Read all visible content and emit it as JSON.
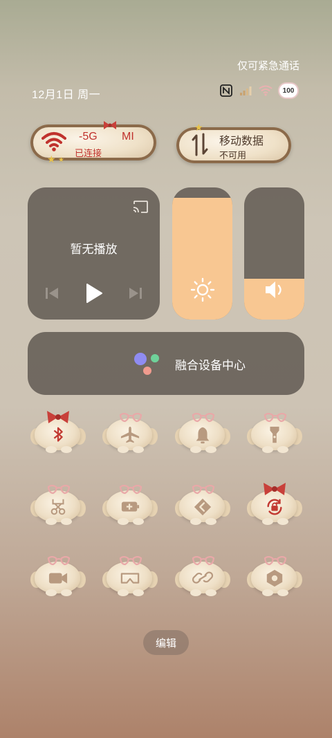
{
  "status_bar": {
    "emergency_text": "仅可紧急通话",
    "date_text": "12月1日 周一",
    "battery_level": "100",
    "icons": [
      "nfc-icon",
      "signal-icon",
      "wifi-icon",
      "battery-icon"
    ]
  },
  "tiles": {
    "wifi": {
      "title_a": "-5G",
      "title_b": "MI",
      "status": "已连接",
      "accent": "#c0322d"
    },
    "mobile_data": {
      "title": "移动数据",
      "status": "不可用"
    }
  },
  "media": {
    "title": "暂无播放",
    "icons": [
      "cast-icon",
      "previous-icon",
      "play-icon",
      "next-icon"
    ]
  },
  "sliders": {
    "brightness": {
      "level": 0.92,
      "icon": "sun-icon",
      "color": "#f8c792"
    },
    "volume": {
      "level": 0.31,
      "icon": "speaker-icon",
      "color": "#f8c792"
    }
  },
  "fusion": {
    "label": "融合设备中心"
  },
  "toggles": [
    {
      "icon": "bluetooth-icon",
      "active": true
    },
    {
      "icon": "airplane-icon",
      "active": false
    },
    {
      "icon": "bell-icon",
      "active": false
    },
    {
      "icon": "flashlight-icon",
      "active": false
    },
    {
      "icon": "screenshot-icon",
      "active": false
    },
    {
      "icon": "battery-saver-icon",
      "active": false
    },
    {
      "icon": "direction-icon",
      "active": false
    },
    {
      "icon": "rotation-lock-icon",
      "active": true
    },
    {
      "icon": "screen-record-icon",
      "active": false
    },
    {
      "icon": "vr-icon",
      "active": false
    },
    {
      "icon": "link-icon",
      "active": false
    },
    {
      "icon": "settings-icon",
      "active": false
    }
  ],
  "edit_button": {
    "label": "编辑"
  }
}
